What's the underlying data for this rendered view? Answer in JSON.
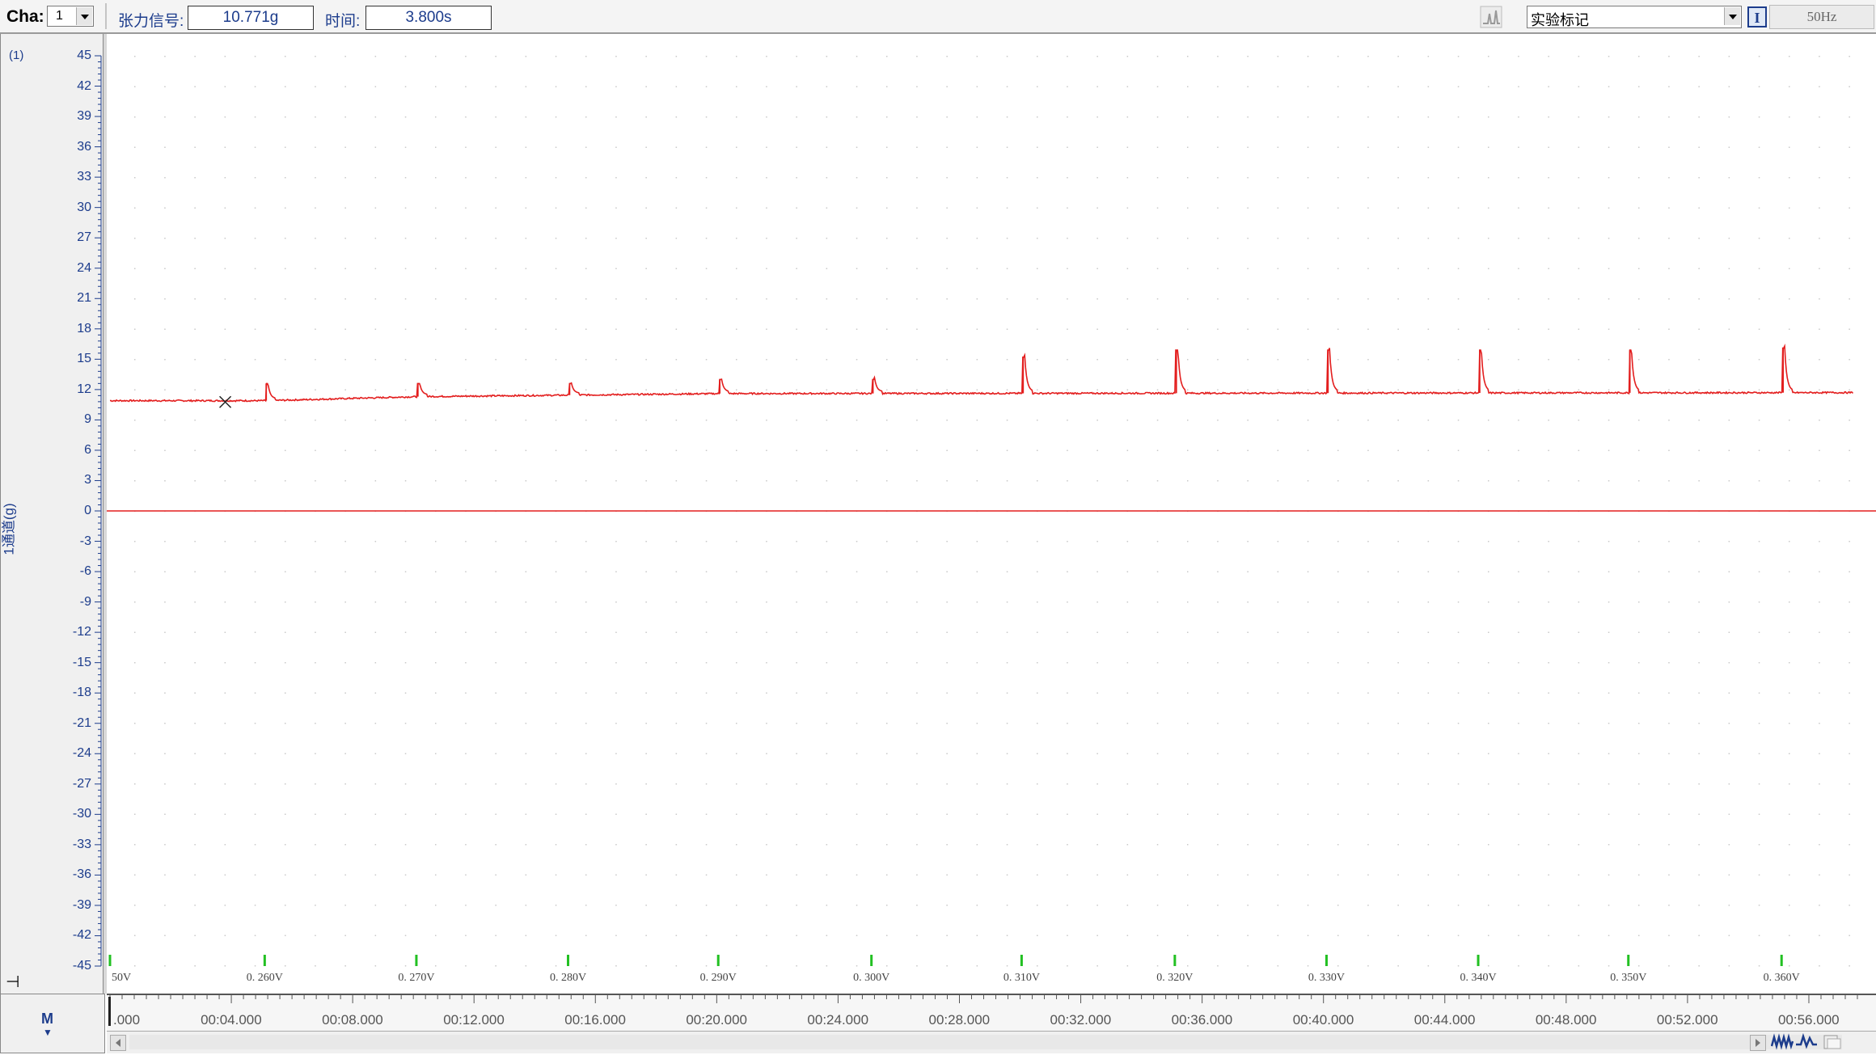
{
  "toolbar": {
    "channel_label": "Cha:",
    "channel_value": "1",
    "signal_label": "张力信号:",
    "signal_value": "10.771g",
    "time_label": "时间:",
    "time_value": "3.800s",
    "mark_value": "实验标记",
    "freq_label": "50Hz"
  },
  "channel": {
    "index_label": "(1)",
    "axis_title": "1通道(g)"
  },
  "icons": {
    "spike": "spike-chart-icon",
    "mark": "marker-i-icon",
    "pin": "pin-icon",
    "m": "m-arrow-icon",
    "wave1": "waveform-compress-icon",
    "wave2": "waveform-expand-icon",
    "print": "print-icon"
  },
  "colors": {
    "signal": "#e31e1e",
    "label": "#1c3c8c",
    "marker": "#22c022"
  },
  "chart_data": {
    "type": "line",
    "ylabel": "1通道(g)",
    "ylim": [
      -45,
      45
    ],
    "yticks": [
      45,
      42,
      39,
      36,
      33,
      30,
      27,
      24,
      21,
      18,
      15,
      12,
      9,
      6,
      3,
      0,
      -3,
      -6,
      -9,
      -12,
      -15,
      -18,
      -21,
      -24,
      -27,
      -30,
      -33,
      -36,
      -39,
      -42,
      -45
    ],
    "xlim": [
      0,
      58
    ],
    "time_ticks": [
      {
        "t": 0,
        "label": ".000"
      },
      {
        "t": 4,
        "label": "00:04.000"
      },
      {
        "t": 8,
        "label": "00:08.000"
      },
      {
        "t": 12,
        "label": "00:12.000"
      },
      {
        "t": 16,
        "label": "00:16.000"
      },
      {
        "t": 20,
        "label": "00:20.000"
      },
      {
        "t": 24,
        "label": "00:24.000"
      },
      {
        "t": 28,
        "label": "00:28.000"
      },
      {
        "t": 32,
        "label": "00:32.000"
      },
      {
        "t": 36,
        "label": "00:36.000"
      },
      {
        "t": 40,
        "label": "00:40.000"
      },
      {
        "t": 44,
        "label": "00:44.000"
      },
      {
        "t": 48,
        "label": "00:48.000"
      },
      {
        "t": 52,
        "label": "00:52.000"
      },
      {
        "t": 56,
        "label": "00:56.000"
      }
    ],
    "stim_markers": [
      {
        "t": 0.0,
        "label": "50V"
      },
      {
        "t": 5.1,
        "label": "0. 260V"
      },
      {
        "t": 10.1,
        "label": "0. 270V"
      },
      {
        "t": 15.1,
        "label": "0. 280V"
      },
      {
        "t": 20.05,
        "label": "0. 290V"
      },
      {
        "t": 25.1,
        "label": "0. 300V"
      },
      {
        "t": 30.05,
        "label": "0. 310V"
      },
      {
        "t": 35.1,
        "label": "0. 320V"
      },
      {
        "t": 40.1,
        "label": "0. 330V"
      },
      {
        "t": 45.1,
        "label": "0. 340V"
      },
      {
        "t": 50.05,
        "label": "0. 350V"
      },
      {
        "t": 55.1,
        "label": "0. 360V"
      }
    ],
    "series": [
      {
        "baseline": [
          [
            0,
            10.9
          ],
          [
            5.15,
            10.9
          ],
          [
            10.15,
            11.3
          ],
          [
            20.1,
            11.6
          ],
          [
            58,
            11.7
          ]
        ],
        "peaks": [
          {
            "t": 5.15,
            "y": 12.6
          },
          {
            "t": 10.15,
            "y": 12.6
          },
          {
            "t": 15.15,
            "y": 12.6
          },
          {
            "t": 20.1,
            "y": 13.0
          },
          {
            "t": 25.15,
            "y": 13.0
          },
          {
            "t": 30.1,
            "y": 15.2
          },
          {
            "t": 35.15,
            "y": 15.9
          },
          {
            "t": 40.15,
            "y": 15.9
          },
          {
            "t": 45.15,
            "y": 15.9
          },
          {
            "t": 50.1,
            "y": 15.9
          },
          {
            "t": 55.15,
            "y": 16.1
          }
        ]
      }
    ],
    "cursor": {
      "t": 3.8,
      "y": 10.771
    },
    "zero_line": 0,
    "grid": true
  }
}
